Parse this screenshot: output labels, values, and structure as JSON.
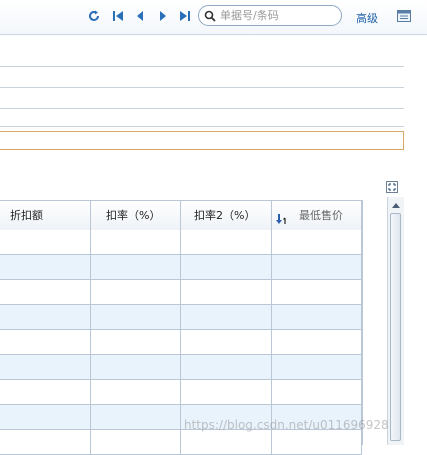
{
  "toolbar": {
    "search_placeholder": "单据号/条码",
    "advanced_label": "高级"
  },
  "grid": {
    "columns": [
      {
        "label": "折扣额"
      },
      {
        "label": "扣率（%）"
      },
      {
        "label": "扣率2（%）"
      },
      {
        "label": "最低售价"
      }
    ],
    "row_count": 9
  },
  "watermark": "https://blog.csdn.net/u011696928",
  "colors": {
    "accent": "#1c5fa8",
    "row_alt": "#e8f3fc",
    "border": "#b9c7d6",
    "highlight_border": "#d8a868"
  }
}
